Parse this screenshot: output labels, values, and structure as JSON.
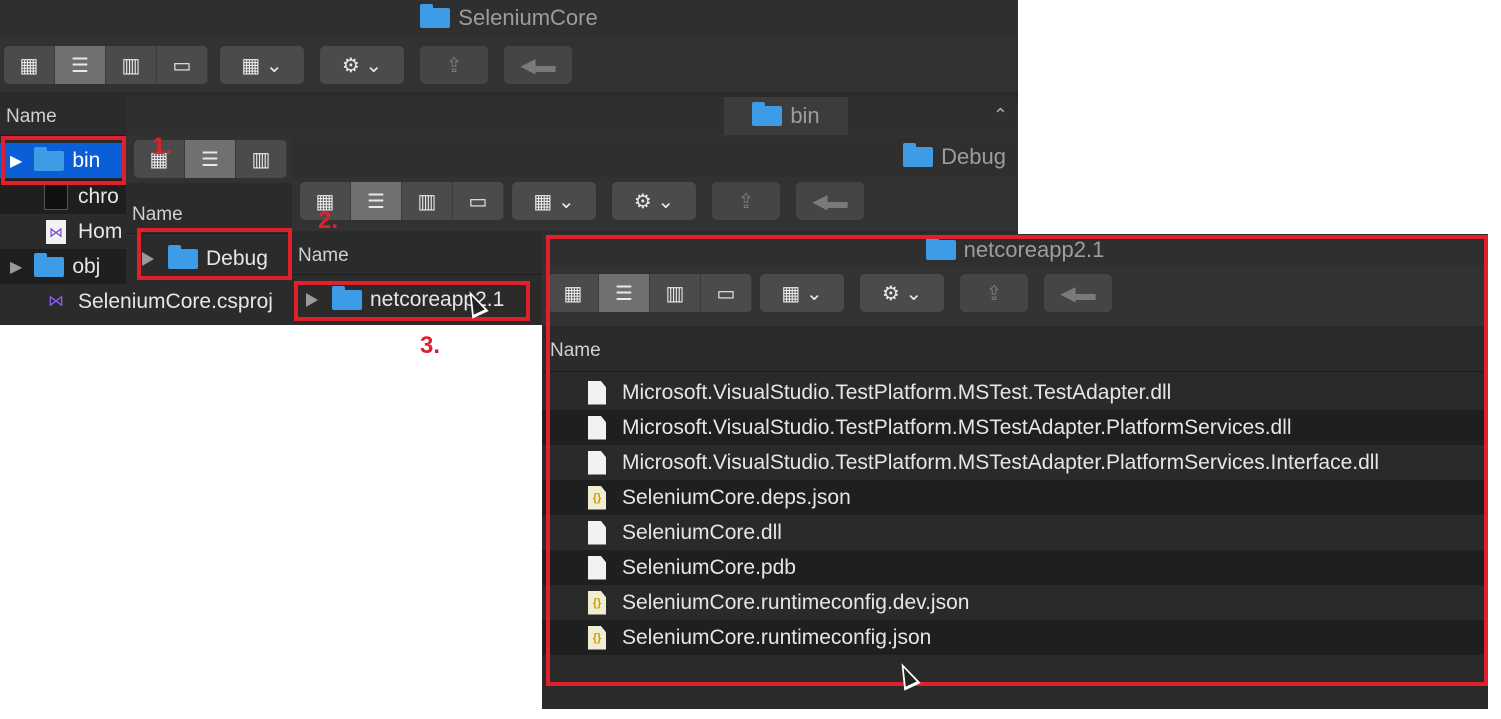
{
  "window1": {
    "title": "SeleniumCore",
    "column_header": "Name",
    "rows": [
      "bin",
      "chro",
      "Hom",
      "obj",
      "SeleniumCore.csproj"
    ]
  },
  "window2": {
    "title": "bin",
    "column_header": "Name",
    "rows": [
      "Debug"
    ]
  },
  "window3": {
    "title": "Debug",
    "column_header": "Name",
    "rows": [
      "netcoreapp2.1"
    ]
  },
  "window4": {
    "title": "netcoreapp2.1",
    "column_header": "Name",
    "files": [
      {
        "name": "Microsoft.VisualStudio.TestPlatform.MSTest.TestAdapter.dll",
        "icon": "doc"
      },
      {
        "name": "Microsoft.VisualStudio.TestPlatform.MSTestAdapter.PlatformServices.dll",
        "icon": "doc"
      },
      {
        "name": "Microsoft.VisualStudio.TestPlatform.MSTestAdapter.PlatformServices.Interface.dll",
        "icon": "doc"
      },
      {
        "name": "SeleniumCore.deps.json",
        "icon": "json"
      },
      {
        "name": "SeleniumCore.dll",
        "icon": "doc"
      },
      {
        "name": "SeleniumCore.pdb",
        "icon": "doc"
      },
      {
        "name": "SeleniumCore.runtimeconfig.dev.json",
        "icon": "json"
      },
      {
        "name": "SeleniumCore.runtimeconfig.json",
        "icon": "json"
      }
    ]
  },
  "steps": [
    "1.",
    "2.",
    "3."
  ],
  "colors": {
    "annotation": "#e0202c",
    "folder": "#3e9be6",
    "selection": "#0a5fd6"
  }
}
